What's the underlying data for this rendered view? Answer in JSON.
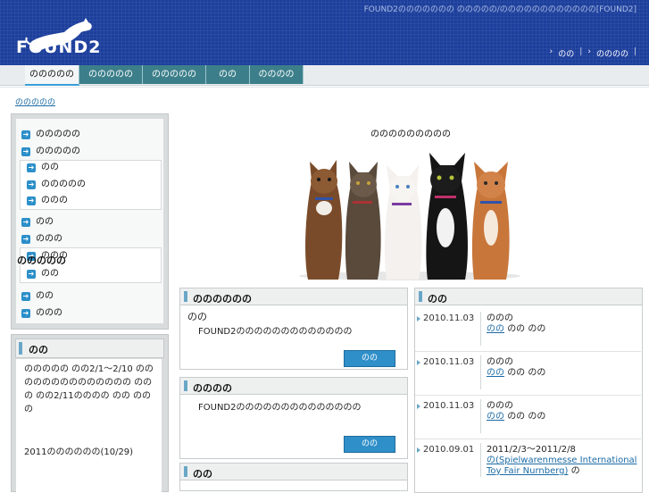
{
  "header": {
    "tagline": "FOUND2ののののののの ののののの/のののののののののののの[FOUND2]",
    "logo_text": "FOUND2",
    "links": [
      {
        "label": "のの"
      },
      {
        "label": "のののの"
      }
    ]
  },
  "nav": {
    "tabs": [
      {
        "label": "ののののの"
      },
      {
        "label": "ののののの"
      },
      {
        "label": "ののののの"
      },
      {
        "label": "のの"
      },
      {
        "label": "のののの"
      }
    ]
  },
  "breadcrumb": "ののののの",
  "sidebar": {
    "items": [
      {
        "label": "ののののの"
      },
      {
        "label": "ののののの"
      },
      {
        "label": "のの"
      },
      {
        "label": "ののののの"
      },
      {
        "label": "ののの"
      },
      {
        "label": "のの"
      },
      {
        "label": "ののの"
      },
      {
        "label": "ののの"
      },
      {
        "label": "のの"
      },
      {
        "label": "のの"
      },
      {
        "label": "ののの"
      }
    ],
    "overlay_label": "ののののの"
  },
  "news_box": {
    "title": "のの",
    "p1": "ののののの のの2/1〜2/10 のののののののののののののの ののの のの2/11のののの のの ののの",
    "p2": "2011のののののの(10/29)"
  },
  "hero": {
    "title": "ののののののののの"
  },
  "panel_a": {
    "title": "のののののの",
    "heading": "のの",
    "text": "FOUND2ののののののののののののの",
    "more": "のの"
  },
  "panel_b": {
    "title": "のののの",
    "text": "FOUND2のののののののののののののの",
    "more": "のの"
  },
  "panel_c": {
    "title": "のの"
  },
  "news_list": {
    "title": "のの",
    "rows": [
      {
        "date": "2010.11.03",
        "line1": "ののの",
        "link": "のの",
        "rest": "のの のの"
      },
      {
        "date": "2010.11.03",
        "line1": "ののの",
        "link": "のの",
        "rest": "のの のの"
      },
      {
        "date": "2010.11.03",
        "line1": "ののの",
        "link": "のの",
        "rest": "のの のの"
      },
      {
        "date": "2010.09.01",
        "line1": "2011/2/3〜2011/2/8",
        "link": "の(Spielwarenmesse International Toy Fair Nurnberg)",
        "rest": "の"
      }
    ]
  }
}
